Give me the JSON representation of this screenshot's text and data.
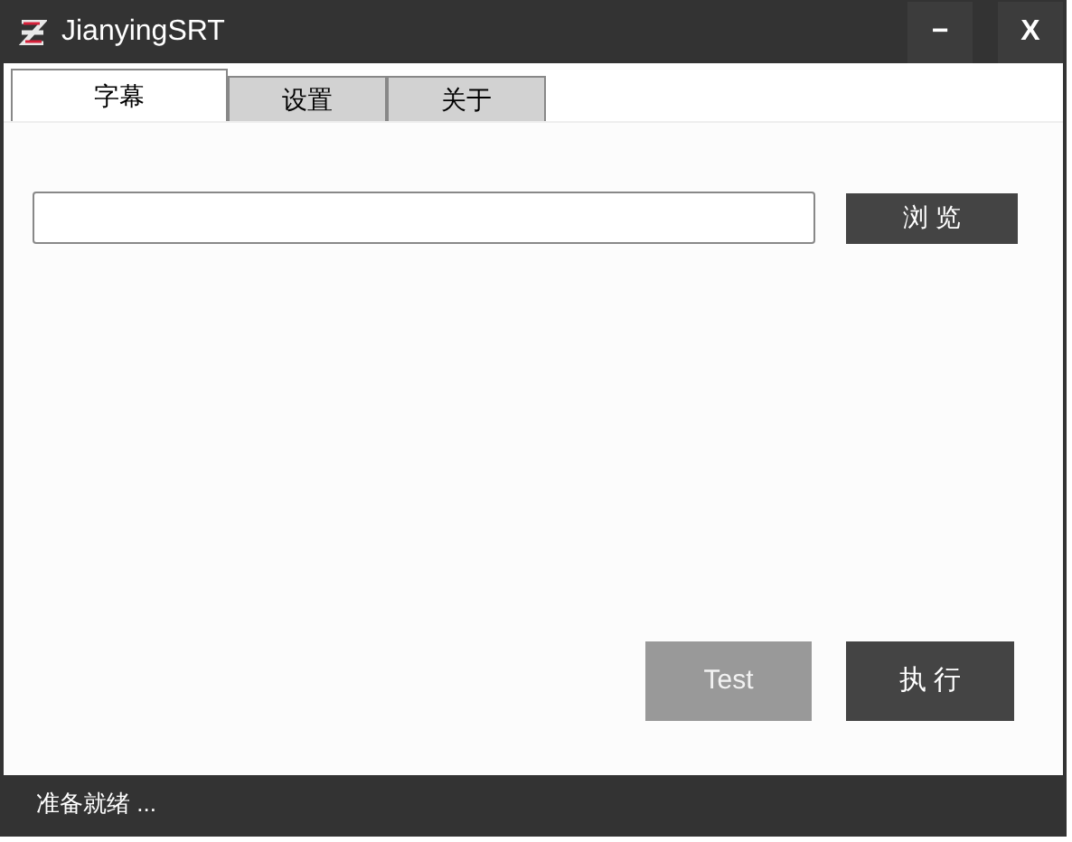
{
  "window": {
    "title": "JianyingSRT",
    "controls": [
      "−",
      "X"
    ]
  },
  "tabs": [
    {
      "label": "字幕",
      "selected": true
    },
    {
      "label": "设置",
      "selected": false
    },
    {
      "label": "关于",
      "selected": false
    }
  ],
  "browse_button": "浏 览",
  "buttons": [
    {
      "label": "Test",
      "disabled": true
    },
    {
      "label": "执 行",
      "disabled": false
    }
  ],
  "status_bar": "准备就绪 ..."
}
